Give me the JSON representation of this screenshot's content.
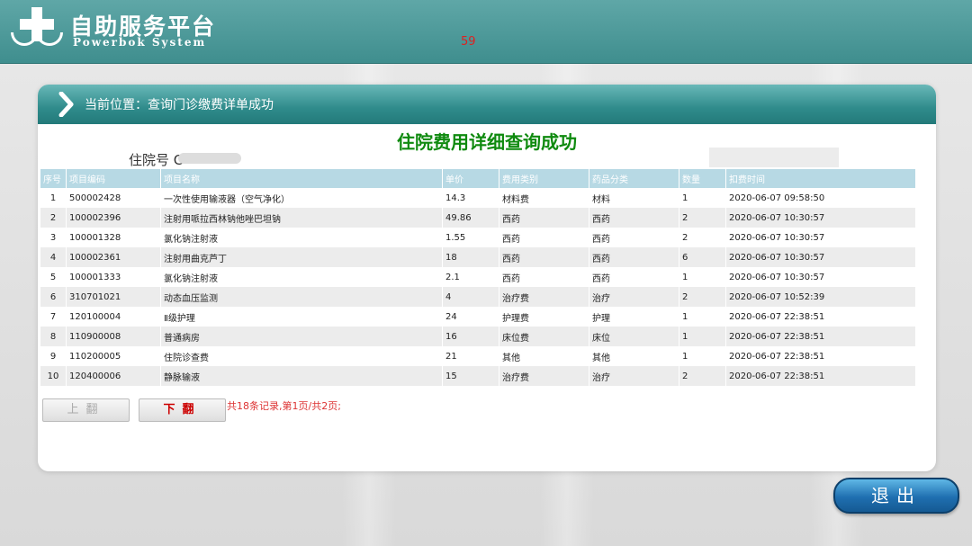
{
  "header": {
    "title": "自助服务平台",
    "subtitle": "Powerbok System",
    "counter": "59"
  },
  "panel": {
    "breadcrumb": "当前位置：查询门诊缴费详单成功",
    "title": "住院费用详细查询成功",
    "admission_label": "住院号",
    "admission_value": "C"
  },
  "table": {
    "columns": [
      "序号",
      "项目编码",
      "项目名称",
      "单价",
      "费用类别",
      "药品分类",
      "数量",
      "扣费时间"
    ],
    "rows": [
      [
        "1",
        "500002428",
        "一次性使用输液器（空气净化）",
        "14.3",
        "材料费",
        "材料",
        "1",
        "2020-06-07 09:58:50"
      ],
      [
        "2",
        "100002396",
        "注射用哌拉西林钠他唑巴坦钠",
        "49.86",
        "西药",
        "西药",
        "2",
        "2020-06-07 10:30:57"
      ],
      [
        "3",
        "100001328",
        "氯化钠注射液",
        "1.55",
        "西药",
        "西药",
        "2",
        "2020-06-07 10:30:57"
      ],
      [
        "4",
        "100002361",
        "注射用曲克芦丁",
        "18",
        "西药",
        "西药",
        "6",
        "2020-06-07 10:30:57"
      ],
      [
        "5",
        "100001333",
        "氯化钠注射液",
        "2.1",
        "西药",
        "西药",
        "1",
        "2020-06-07 10:30:57"
      ],
      [
        "6",
        "310701021",
        "动态血压监测",
        "4",
        "治疗费",
        "治疗",
        "2",
        "2020-06-07 10:52:39"
      ],
      [
        "7",
        "120100004",
        "Ⅱ级护理",
        "24",
        "护理费",
        "护理",
        "1",
        "2020-06-07 22:38:51"
      ],
      [
        "8",
        "110900008",
        "普通病房",
        "16",
        "床位费",
        "床位",
        "1",
        "2020-06-07 22:38:51"
      ],
      [
        "9",
        "110200005",
        "住院诊查费",
        "21",
        "其他",
        "其他",
        "1",
        "2020-06-07 22:38:51"
      ],
      [
        "10",
        "120400006",
        "静脉输液",
        "15",
        "治疗费",
        "治疗",
        "2",
        "2020-06-07 22:38:51"
      ]
    ]
  },
  "pager": {
    "prev_label": "上翻",
    "next_label": "下翻",
    "summary": "共18条记录,第1页/共2页;"
  },
  "exit_label": "退出",
  "colors": {
    "header_bg": "#4f9c9c",
    "title_green": "#0f8a0f",
    "table_header": "#b7d9e4",
    "pager_red": "#d33"
  },
  "icons": {
    "logo": "medical-cross-icon",
    "breadcrumb": "chevron-right-icon"
  }
}
